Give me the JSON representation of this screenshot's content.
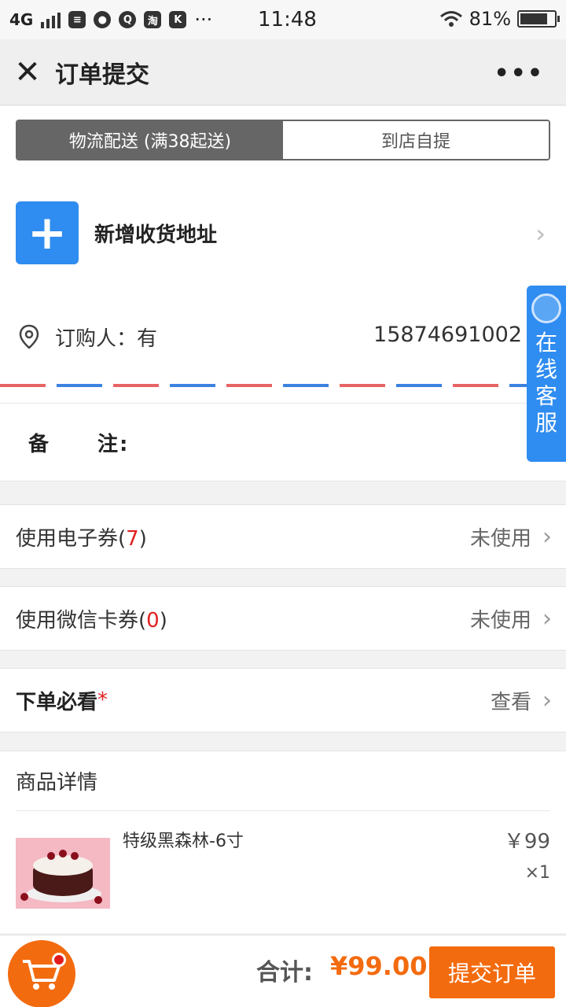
{
  "status_bar": {
    "network": "4G",
    "time": "11:48",
    "battery": "81%",
    "battery_level": 0.81,
    "app_icon_labels": [
      "淘",
      "K"
    ],
    "overflow": "···"
  },
  "nav": {
    "close_symbol": "✕",
    "title": "订单提交",
    "more_symbol": "•••"
  },
  "delivery_tabs": [
    {
      "label": "物流配送 (满38起送)",
      "selected": true
    },
    {
      "label": "到店自提",
      "selected": false
    }
  ],
  "address": {
    "add_symbol": "+",
    "add_label": "新增收货地址",
    "chevron": "›"
  },
  "orderer": {
    "label": "订购人：有",
    "phone": "15874691002"
  },
  "remark": {
    "label_a": "备",
    "label_b": "注:"
  },
  "service": {
    "label": "在线客服"
  },
  "coupon_row": {
    "label_prefix": "使用电子券(",
    "count": "7",
    "label_suffix": ")",
    "status": "未使用",
    "chevron": "›"
  },
  "wechat_row": {
    "label_prefix": "使用微信卡券(",
    "count": "0",
    "label_suffix": ")",
    "status": "未使用",
    "chevron": "›"
  },
  "notice_row": {
    "label": "下单必看",
    "required_mark": "*",
    "action": "查看",
    "chevron": "›"
  },
  "goods": {
    "header": "商品详情",
    "items": [
      {
        "name": "特级黑森林-6寸",
        "price": "￥99",
        "qty": "×1"
      }
    ]
  },
  "footer": {
    "total_label": "合计:",
    "total_value": "¥99.00",
    "submit_label": "提交订单"
  },
  "colors": {
    "accent_blue": "#2f8cf0",
    "accent_orange": "#f36b0f",
    "alert_red": "#e02020"
  }
}
